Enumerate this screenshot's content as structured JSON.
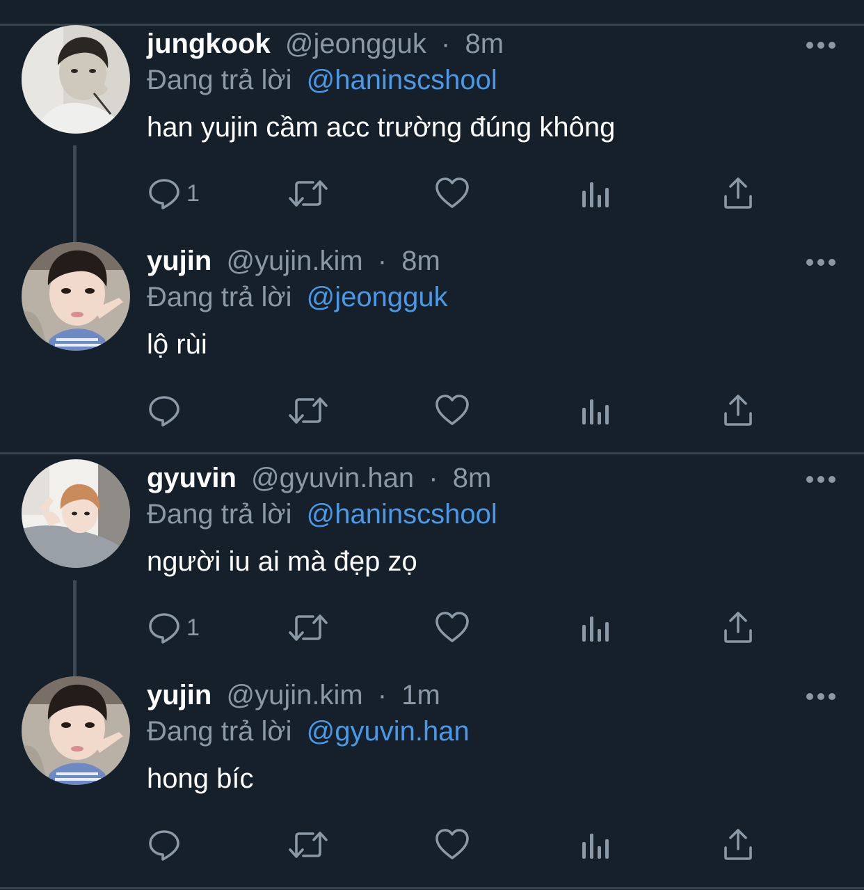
{
  "tweets": [
    {
      "name": "jungkook",
      "handle": "@jeongguk",
      "dot": "·",
      "time": "8m",
      "replying_prefix": "Đang trả lời",
      "replying_to": "@haninscshool",
      "text": "han yujin cầm acc trường đúng không",
      "reply_count": "1",
      "avatar": "avatar-jungkook"
    },
    {
      "name": "yujin",
      "handle": "@yujin.kim",
      "dot": "·",
      "time": "8m",
      "replying_prefix": "Đang trả lời",
      "replying_to": "@jeongguk",
      "text": "lộ rùi",
      "reply_count": "",
      "avatar": "avatar-yujin"
    },
    {
      "name": "gyuvin",
      "handle": "@gyuvin.han",
      "dot": "·",
      "time": "8m",
      "replying_prefix": "Đang trả lời",
      "replying_to": "@haninscshool",
      "text": "người iu ai mà đẹp zọ",
      "reply_count": "1",
      "avatar": "avatar-gyuvin"
    },
    {
      "name": "yujin",
      "handle": "@yujin.kim",
      "dot": "·",
      "time": "1m",
      "replying_prefix": "Đang trả lời",
      "replying_to": "@gyuvin.han",
      "text": "hong bíc",
      "reply_count": "",
      "avatar": "avatar-yujin"
    }
  ],
  "icons": {
    "reply": "reply-icon",
    "retweet": "retweet-icon",
    "like": "like-icon",
    "views": "views-icon",
    "share": "share-icon",
    "more": "more-icon"
  },
  "colors": {
    "background": "#15202b",
    "divider": "#38444d",
    "secondary_text": "#8b98a5",
    "mention": "#4a99e9"
  }
}
